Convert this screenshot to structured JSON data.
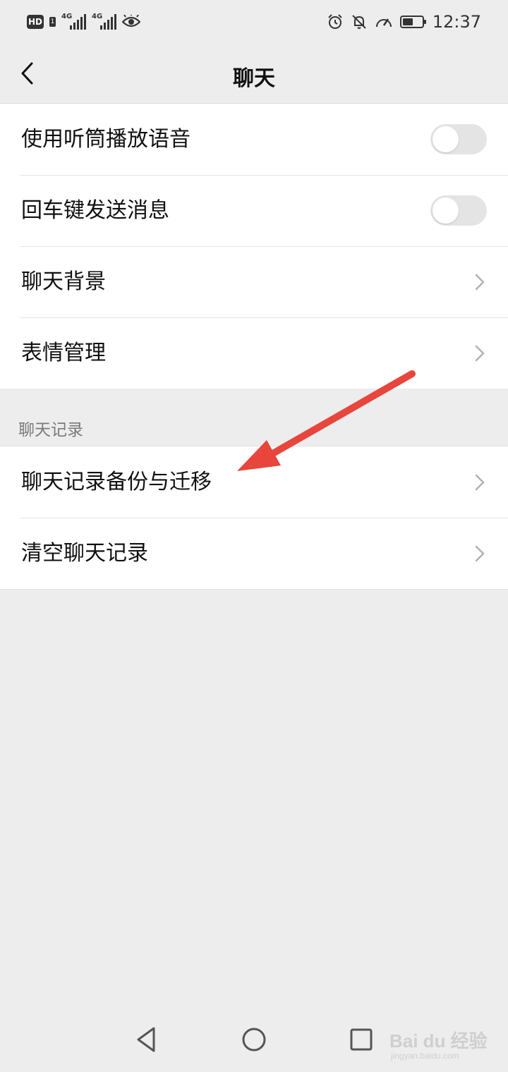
{
  "status_bar": {
    "left_badge": "HD",
    "sim_1": "1",
    "net_1": "4G",
    "net_2": "4G",
    "time": "12:37",
    "icons": [
      "hd-icon",
      "signal-icon",
      "signal-icon",
      "eye-icon",
      "alarm-icon",
      "mute-bell-icon",
      "speed-icon",
      "battery-icon"
    ],
    "battery_level": 0.55
  },
  "header": {
    "title": "聊天",
    "back_icon": "chevron-left-icon"
  },
  "settings": {
    "items": [
      {
        "label": "使用听筒播放语音",
        "control": "toggle",
        "on": false
      },
      {
        "label": "回车键发送消息",
        "control": "toggle",
        "on": false
      },
      {
        "label": "聊天背景",
        "control": "chevron"
      },
      {
        "label": "表情管理",
        "control": "chevron"
      }
    ]
  },
  "chat_history": {
    "section_title": "聊天记录",
    "items": [
      {
        "label": "聊天记录备份与迁移",
        "control": "chevron"
      },
      {
        "label": "清空聊天记录",
        "control": "chevron"
      }
    ]
  },
  "annotation": {
    "color": "#e8453c",
    "icon": "arrow-icon"
  },
  "system_nav": {
    "icons": [
      "back-triangle-icon",
      "home-circle-icon",
      "recents-square-icon"
    ]
  },
  "watermark": {
    "text": "Bai du 经验",
    "sub": "jingyan.baidu.com"
  }
}
